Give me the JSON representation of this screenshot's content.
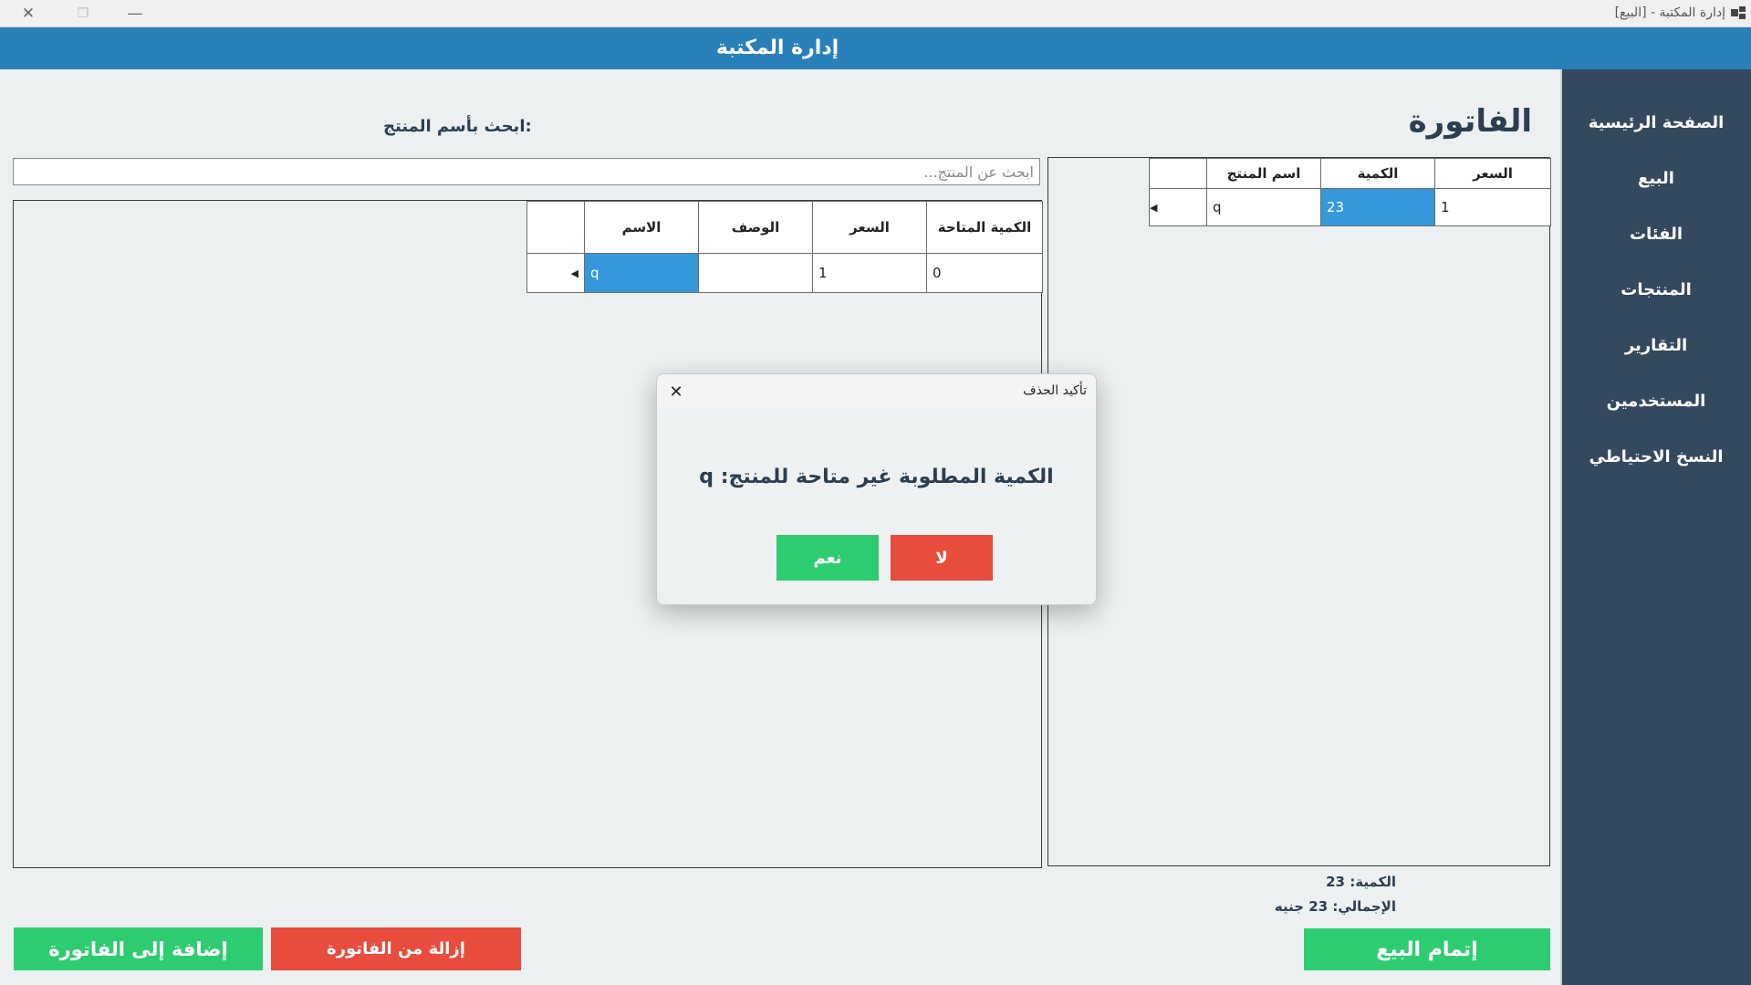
{
  "window": {
    "title": "إدارة المكتبة - [البيع]",
    "close_glyph": "✕",
    "restore_glyph": "❐",
    "minimize_glyph": "—"
  },
  "header": {
    "title": "إدارة المكتبة"
  },
  "sidebar": {
    "items": [
      {
        "label": "الصفحة الرئيسية"
      },
      {
        "label": "البيع"
      },
      {
        "label": "الفئات"
      },
      {
        "label": "المنتجات"
      },
      {
        "label": "التقارير"
      },
      {
        "label": "المستخدمين"
      },
      {
        "label": "النسخ الاحتياطي"
      }
    ]
  },
  "invoice": {
    "title": "الفاتورة",
    "columns": [
      "اسم المنتج",
      "الكمية",
      "السعر"
    ],
    "rows": [
      {
        "name": "q",
        "quantity": "23",
        "price": "1"
      }
    ],
    "quantity_label": "الكمية:",
    "quantity_value": "23",
    "total_label": "الإجمالي:",
    "total_value": "23 جنيه",
    "complete_button": "إتمام البيع"
  },
  "search": {
    "label": "ابحث بأسم المنتج:",
    "placeholder": "ابحث عن المنتج..."
  },
  "products": {
    "columns": [
      "الاسم",
      "الوصف",
      "السعر",
      "الكمية المتاحة"
    ],
    "rows": [
      {
        "name": "q",
        "description": "",
        "price": "1",
        "available": "0"
      }
    ]
  },
  "actions": {
    "add_button": "إضافة إلى الفاتورة",
    "remove_button": "إزالة من الفاتورة"
  },
  "dialog": {
    "title": "تأكيد الحذف",
    "message": "الكمية المطلوبة غير متاحة للمنتج: q",
    "yes_button": "نعم",
    "no_button": "لا",
    "close_glyph": "✕"
  },
  "colors": {
    "header": "#2980b9",
    "sidebar": "#34495e",
    "selection": "#3498db",
    "confirm": "#2ecc71",
    "danger": "#e74c3c"
  }
}
